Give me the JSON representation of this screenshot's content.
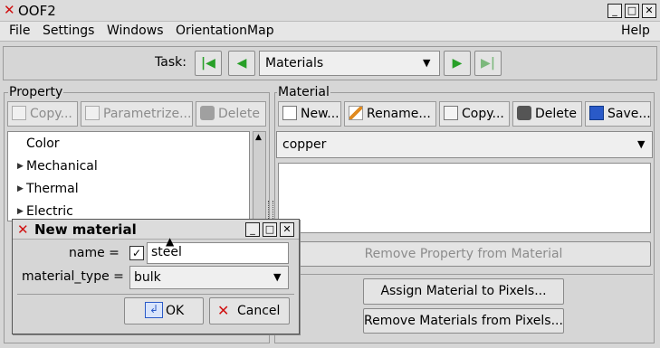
{
  "window": {
    "title": "OOF2"
  },
  "menubar": {
    "file": "File",
    "settings": "Settings",
    "windows": "Windows",
    "orientation_map": "OrientationMap",
    "help": "Help"
  },
  "task": {
    "label": "Task:",
    "value": "Materials"
  },
  "property_panel": {
    "title": "Property",
    "copy": "Copy...",
    "parametrize": "Parametrize...",
    "delete": "Delete",
    "items": [
      "Color",
      "Mechanical",
      "Thermal",
      "Electric"
    ]
  },
  "material_panel": {
    "title": "Material",
    "new": "New...",
    "rename": "Rename...",
    "copy": "Copy...",
    "delete": "Delete",
    "save": "Save...",
    "selected": "copper",
    "remove_property": "Remove Property from Material",
    "assign": "Assign Material to Pixels...",
    "remove_materials": "Remove Materials from Pixels..."
  },
  "dialog": {
    "title": "New material",
    "name_label": "name =",
    "name_value": "steel",
    "name_checked": true,
    "type_label": "material_type =",
    "type_value": "bulk",
    "ok": "OK",
    "cancel": "Cancel"
  },
  "colors": {
    "green_arrow": "#28a028",
    "close_red": "#d01010"
  }
}
